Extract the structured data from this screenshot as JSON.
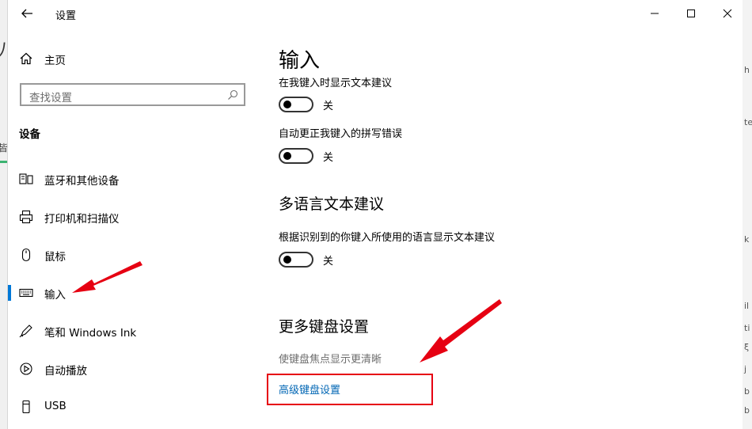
{
  "window": {
    "title": "设置"
  },
  "sidebar": {
    "home_label": "主页",
    "search_placeholder": "查找设置",
    "section_title": "设备",
    "items": [
      {
        "label": "蓝牙和其他设备",
        "icon": "bluetooth-devices-icon"
      },
      {
        "label": "打印机和扫描仪",
        "icon": "printer-icon"
      },
      {
        "label": "鼠标",
        "icon": "mouse-icon"
      },
      {
        "label": "输入",
        "icon": "keyboard-icon",
        "active": true
      },
      {
        "label": "笔和 Windows Ink",
        "icon": "pen-icon"
      },
      {
        "label": "自动播放",
        "icon": "autoplay-icon"
      },
      {
        "label": "USB",
        "icon": "usb-icon"
      }
    ]
  },
  "main": {
    "title": "输入",
    "settings": [
      {
        "label": "在我键入时显示文本建议",
        "state": "关"
      },
      {
        "label": "自动更正我键入的拼写错误",
        "state": "关"
      }
    ],
    "multilang": {
      "title": "多语言文本建议",
      "label": "根据识别到的你键入所使用的语言显示文本建议",
      "state": "关"
    },
    "more": {
      "title": "更多键盘设置",
      "desc": "使键盘焦点显示更清晰",
      "link": "高级键盘设置"
    }
  },
  "colors": {
    "accent": "#0078d7",
    "link": "#0066b4",
    "annotation": "#e60012"
  }
}
